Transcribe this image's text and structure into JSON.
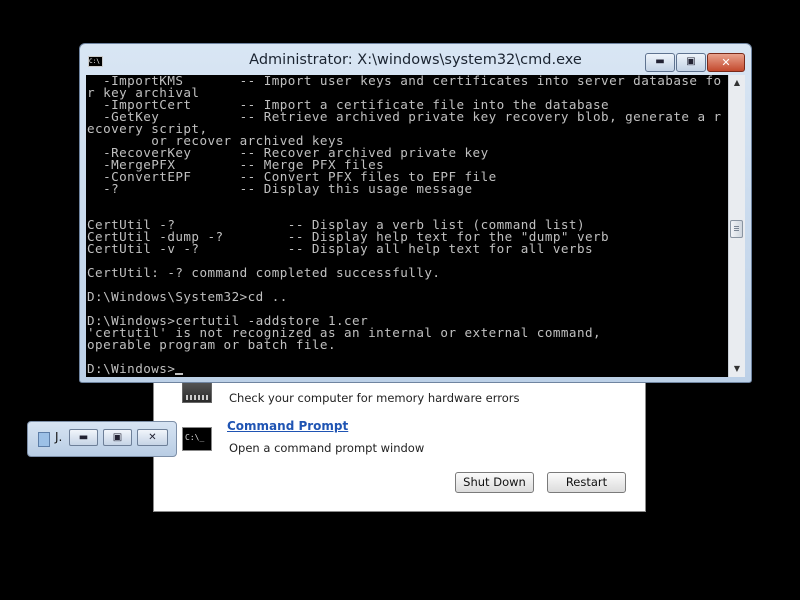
{
  "recovery_dialog": {
    "memory_tool_description": "Check your computer for memory hardware errors",
    "command_prompt_title": "Command Prompt",
    "command_prompt_description": "Open a command prompt window",
    "command_prompt_icon_text": "C:\\_",
    "shutdown_label": "Shut Down",
    "restart_label": "Restart"
  },
  "mini_window": {
    "title": "J.",
    "min_glyph": "▬",
    "max_glyph": "▣",
    "close_glyph": "✕"
  },
  "cmd_window": {
    "title": "Administrator: X:\\windows\\system32\\cmd.exe",
    "icon_text": "C:\\",
    "min_glyph": "▬",
    "max_glyph": "▣",
    "close_glyph": "✕",
    "console_lines": [
      "  -ImportKMS       -- Import user keys and certificates into server database fo",
      "r key archival",
      "  -ImportCert      -- Import a certificate file into the database",
      "  -GetKey          -- Retrieve archived private key recovery blob, generate a r",
      "ecovery script,",
      "        or recover archived keys",
      "  -RecoverKey      -- Recover archived private key",
      "  -MergePFX        -- Merge PFX files",
      "  -ConvertEPF      -- Convert PFX files to EPF file",
      "  -?               -- Display this usage message",
      "",
      "",
      "CertUtil -?              -- Display a verb list (command list)",
      "CertUtil -dump -?        -- Display help text for the \"dump\" verb",
      "CertUtil -v -?           -- Display all help text for all verbs",
      "",
      "CertUtil: -? command completed successfully.",
      "",
      "D:\\Windows\\System32>cd ..",
      "",
      "D:\\Windows>certutil -addstore 1.cer",
      "'certutil' is not recognized as an internal or external command,",
      "operable program or batch file.",
      "",
      "D:\\Windows>"
    ],
    "scroll_up_glyph": "▲",
    "scroll_down_glyph": "▼"
  }
}
